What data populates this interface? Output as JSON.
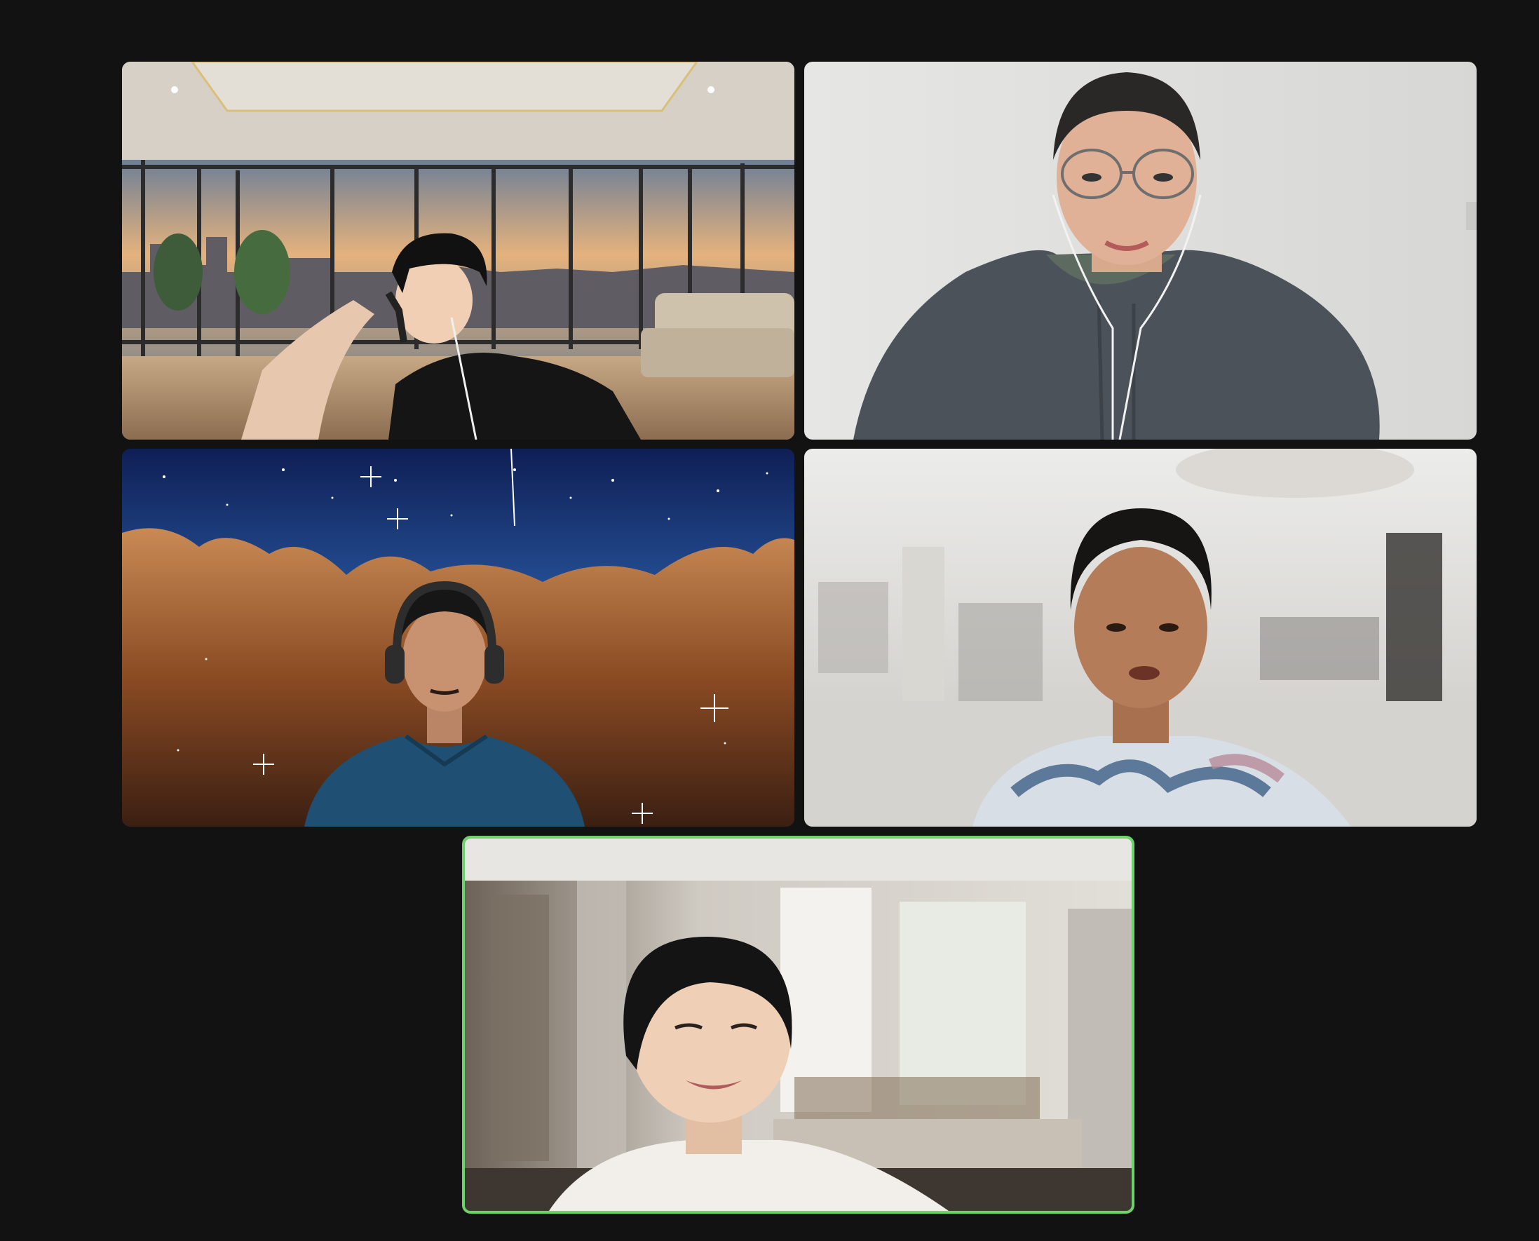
{
  "meeting": {
    "layout": "gallery-view",
    "active_speaker_color": "#6ed26a",
    "participants": [
      {
        "id": 1,
        "background": "virtual-penthouse-sunset",
        "wearing": "earphones"
      },
      {
        "id": 2,
        "background": "plain-white-wall",
        "wearing": "glasses-and-earphones"
      },
      {
        "id": 3,
        "background": "virtual-nebula-space",
        "wearing": "headphones"
      },
      {
        "id": 4,
        "background": "blurred-kitchen",
        "wearing": "tie-dye-shirt"
      },
      {
        "id": 5,
        "background": "blurred-living-room",
        "active_speaker": true
      }
    ]
  }
}
